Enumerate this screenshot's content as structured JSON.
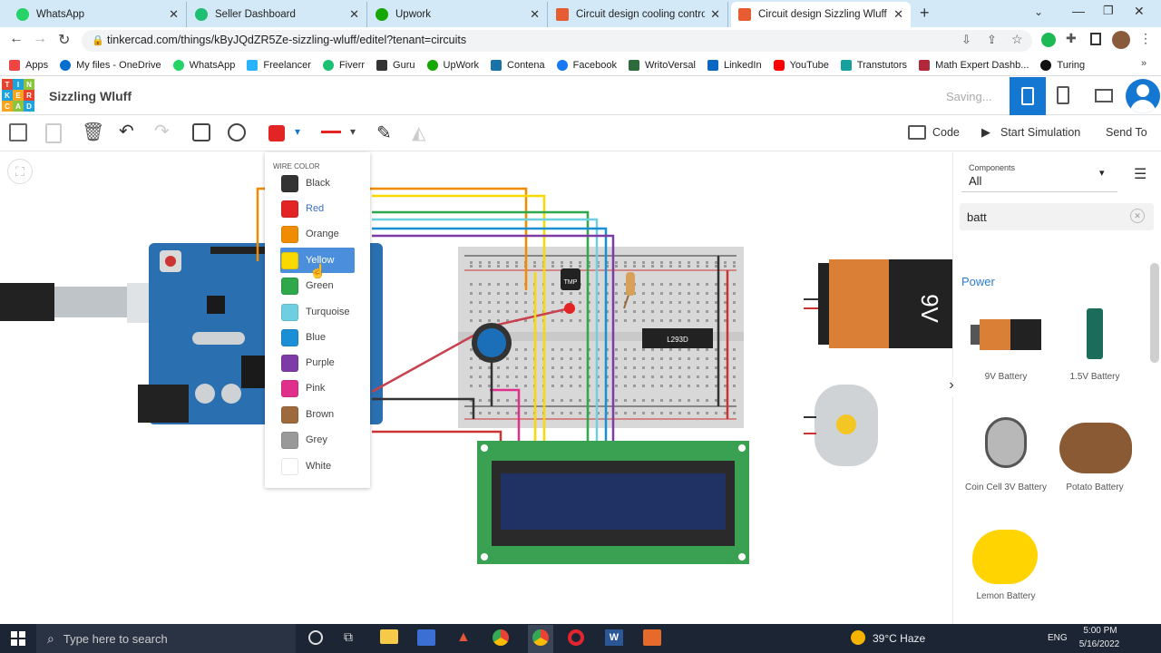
{
  "browser": {
    "tabs": [
      {
        "label": "WhatsApp",
        "color": "#25d366"
      },
      {
        "label": "Seller Dashboard",
        "color": "#1dbf73"
      },
      {
        "label": "Upwork",
        "color": "#14a800"
      },
      {
        "label": "Circuit design cooling control | Ti",
        "color": "#e65c33"
      },
      {
        "label": "Circuit design Sizzling Wluff | Tin",
        "color": "#e65c33"
      }
    ],
    "url": "tinkercad.com/things/kByJQdZR5Ze-sizzling-wluff/editel?tenant=circuits",
    "bookmarks": [
      "Apps",
      "My files - OneDrive",
      "WhatsApp",
      "Freelancer",
      "Fiverr",
      "Guru",
      "UpWork",
      "Contena",
      "Facebook",
      "WritoVersal",
      "LinkedIn",
      "YouTube",
      "Transtutors",
      "Math Expert Dashb...",
      "Turing"
    ]
  },
  "app": {
    "logo_letters": [
      "T",
      "I",
      "N",
      "K",
      "E",
      "R",
      "C",
      "A",
      "D"
    ],
    "title": "Sizzling Wluff",
    "saving": "Saving...",
    "code_label": "Code",
    "simulate_label": "Start Simulation",
    "send_label": "Send To"
  },
  "wire_menu": {
    "header": "WIRE COLOR",
    "items": [
      {
        "label": "Black",
        "color": "#333333"
      },
      {
        "label": "Red",
        "color": "#e32424"
      },
      {
        "label": "Orange",
        "color": "#f08c00"
      },
      {
        "label": "Yellow",
        "color": "#f9d900"
      },
      {
        "label": "Green",
        "color": "#2ea84a"
      },
      {
        "label": "Turquoise",
        "color": "#6ecfe0"
      },
      {
        "label": "Blue",
        "color": "#1a8fd6"
      },
      {
        "label": "Purple",
        "color": "#7d3ba6"
      },
      {
        "label": "Pink",
        "color": "#e0308c"
      },
      {
        "label": "Brown",
        "color": "#9c6a3c"
      },
      {
        "label": "Grey",
        "color": "#999999"
      },
      {
        "label": "White",
        "color": "#ffffff"
      }
    ],
    "selected": "Yellow"
  },
  "components_panel": {
    "label": "Components",
    "filter": "All",
    "search": "batt",
    "section": "Power",
    "items": [
      "9V Battery",
      "1.5V Battery",
      "Coin Cell 3V Battery",
      "Potato Battery",
      "Lemon Battery"
    ]
  },
  "canvas": {
    "chip_label": "L293D",
    "sensor_label": "TMP",
    "battery_label": "9V"
  },
  "taskbar": {
    "search_placeholder": "Type here to search",
    "weather": "39°C Haze",
    "lang": "ENG",
    "time": "5:00 PM",
    "date": "5/16/2022"
  }
}
